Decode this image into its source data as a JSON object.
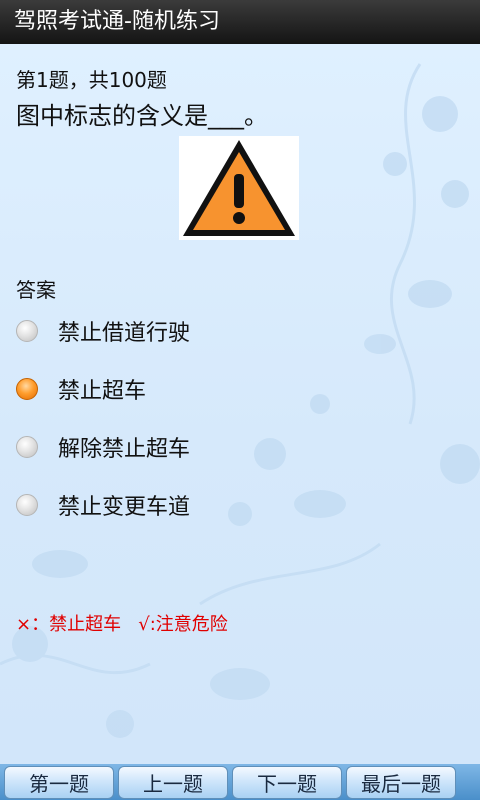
{
  "header": {
    "title": "驾照考试通-随机练习"
  },
  "question": {
    "number_label": "第1题，共100题",
    "text": "图中标志的含义是___。",
    "image_icon": "warning-triangle-exclamation"
  },
  "answers": {
    "label": "答案",
    "options": [
      {
        "label": "禁止借道行驶",
        "selected": false
      },
      {
        "label": "禁止超车",
        "selected": true
      },
      {
        "label": "解除禁止超车",
        "selected": false
      },
      {
        "label": "禁止变更车道",
        "selected": false
      }
    ]
  },
  "feedback": {
    "text": "×：禁止超车   √:注意危险",
    "color": "#e00000"
  },
  "nav": {
    "first": "第一题",
    "prev": "上一题",
    "next": "下一题",
    "last": "最后一题"
  },
  "colors": {
    "accent": "#ff9e2e",
    "background": "#d8ebfb",
    "titlebar": "#1f1f1f"
  }
}
